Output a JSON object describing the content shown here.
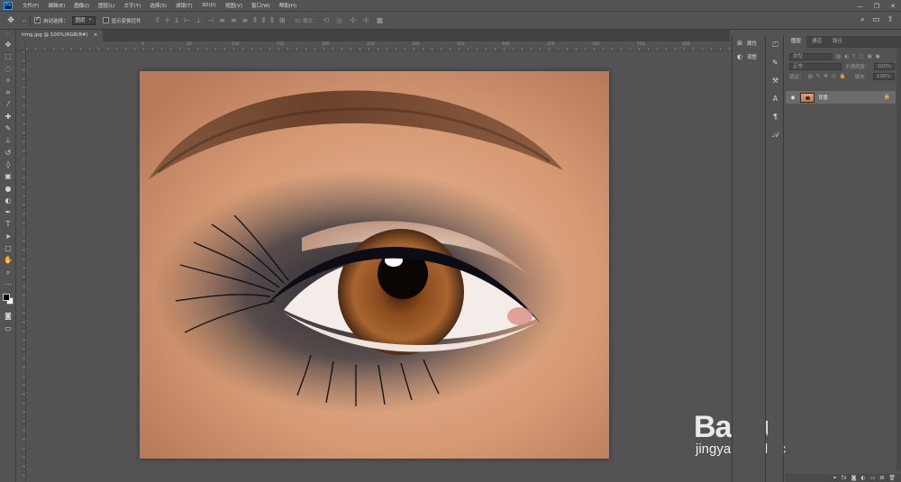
{
  "app": {
    "logo_text": "Ps"
  },
  "menu": [
    "文件(F)",
    "编辑(E)",
    "图像(I)",
    "图层(L)",
    "文字(Y)",
    "选择(S)",
    "滤镜(T)",
    "3D(D)",
    "视图(V)",
    "窗口(W)",
    "帮助(H)"
  ],
  "window_controls": {
    "minimize": "—",
    "restore": "❐",
    "close": "✕"
  },
  "options_bar": {
    "auto_select_label": "自动选择：",
    "auto_select_target": "图层",
    "show_transform_label": "显示变换控件",
    "mode_3d_label": "3D 模式："
  },
  "document": {
    "tab_title": "timg.jpg @ 100%(RGB/8#)",
    "tab_close": "×",
    "ruler_ticks": [
      "0",
      "50",
      "100",
      "150",
      "200",
      "250",
      "300",
      "350",
      "400",
      "450",
      "500",
      "550",
      "600",
      "650",
      "700",
      "750"
    ]
  },
  "side_panels": {
    "properties_label": "属性",
    "adjustments_label": "调整"
  },
  "layers_panel": {
    "tabs": [
      "图层",
      "通道",
      "路径"
    ],
    "active_tab": "图层",
    "filter_placeholder": "类型",
    "blend_mode": "正常",
    "opacity_label": "不透明度：",
    "opacity_value": "100%",
    "lock_label": "锁定：",
    "fill_label": "填充：",
    "fill_value": "100%",
    "layers": [
      {
        "name": "背景",
        "visible": true,
        "locked": true
      }
    ]
  },
  "watermark": {
    "brand": "Bai du 经验",
    "url": "jingyan.baidu.com"
  }
}
